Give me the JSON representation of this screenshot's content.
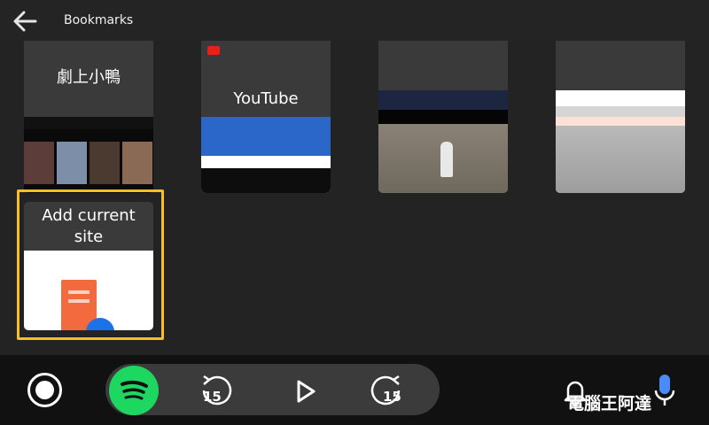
{
  "header": {
    "title": "Bookmarks",
    "back_icon": "arrow-left-icon"
  },
  "bookmarks": [
    {
      "title_line1": "",
      "title_line2": "劇上小鴨",
      "thumbnail": "movie-grid"
    },
    {
      "title_line1": "",
      "title_line2": "YouTube",
      "thumbnail": "youtube-page"
    },
    {
      "title_line1": "",
      "title_line2": "",
      "thumbnail": "line-hub-page"
    },
    {
      "title_line1": "",
      "title_line2": "",
      "thumbnail": "line-today-page"
    }
  ],
  "add_current": {
    "label_line1": "Add current",
    "label_line2": "site",
    "icon": "add-document-icon",
    "selected": true,
    "highlight_color": "#f6c025"
  },
  "bottom_bar": {
    "home_icon": "home-circle-icon",
    "spotify_icon": "spotify-icon",
    "spotify_color": "#1ed760",
    "rewind_label": "15",
    "play_icon": "play-icon",
    "forward_label": "15",
    "notification_icon": "bell-icon",
    "mic_icon": "mic-icon"
  },
  "watermark": {
    "text": "電腦王阿達",
    "url": "http://www.kocpc.com.tw"
  }
}
